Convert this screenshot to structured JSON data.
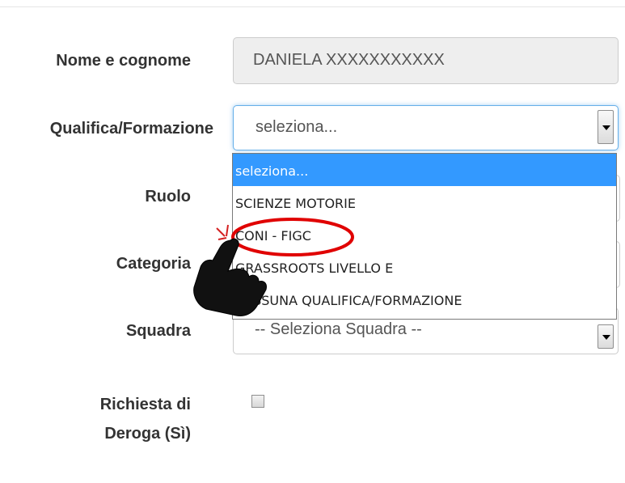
{
  "form": {
    "name_label": "Nome e cognome",
    "name_value": "DANIELA XXXXXXXXXXX",
    "qualifica_label": "Qualifica/Formazione",
    "qualifica_value": "seleziona...",
    "qualifica_options": [
      "seleziona...",
      "SCIENZE MOTORIE",
      "CONI - FIGC",
      "GRASSROOTS LIVELLO E",
      "NESSUNA QUALIFICA/FORMAZIONE"
    ],
    "ruolo_label": "Ruolo",
    "categoria_label": "Categoria",
    "squadra_label": "Squadra",
    "squadra_value": "-- Seleziona Squadra --",
    "deroga_label_line1": "Richiesta di",
    "deroga_label_line2": "Deroga (Sì)"
  },
  "annotation": {
    "highlight_color": "#e00000",
    "highlighted_option": "CONI - FIGC",
    "pointer_icon": "hand-pointer-icon"
  }
}
